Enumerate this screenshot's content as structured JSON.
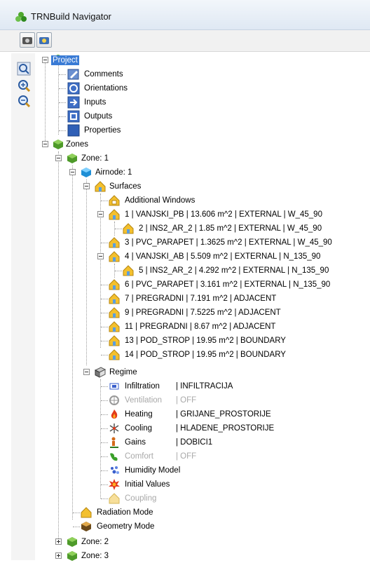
{
  "window": {
    "title": "TRNBuild Navigator"
  },
  "toolbar": {
    "buttons": [
      "camera-icon",
      "camera-color-icon"
    ]
  },
  "sidebar": {
    "buttons": [
      "zoom-fit-icon",
      "zoom-in-icon",
      "zoom-out-icon"
    ]
  },
  "tree": {
    "project": "Project",
    "comments": "Comments",
    "orientations": "Orientations",
    "inputs": "Inputs",
    "outputs": "Outputs",
    "properties": "Properties",
    "zones": "Zones",
    "zone1": "Zone: 1",
    "airnode1": "Airnode: 1",
    "surfaces": "Surfaces",
    "additional_windows": "Additional Windows",
    "surface_items": [
      "1  |  VANJSKI_PB  |  13.606 m^2  |  EXTERNAL  |  W_45_90",
      "2  |  INS2_AR_2  |  1.85 m^2  |  EXTERNAL  |  W_45_90",
      "3  |  PVC_PARAPET  |  1.3625 m^2  |  EXTERNAL  |  W_45_90",
      "4  |  VANJSKI_AB  |  5.509 m^2  |  EXTERNAL  |  N_135_90",
      "5  |  INS2_AR_2  |  4.292 m^2  |  EXTERNAL  |  N_135_90",
      "6  |  PVC_PARAPET  |  3.161 m^2  |  EXTERNAL  |  N_135_90",
      "7  |  PREGRADNI  |  7.191 m^2  |  ADJACENT",
      "9  |  PREGRADNI  |  7.5225 m^2  |  ADJACENT",
      "11  |  PREGRADNI  |  8.67 m^2  |  ADJACENT",
      "13  |  POD_STROP  |  19.95 m^2  |  BOUNDARY",
      "14  |  POD_STROP  |  19.95 m^2  |  BOUNDARY"
    ],
    "regime": "Regime",
    "regime_items": [
      {
        "name": "Infiltration",
        "value": "|  INFILTRACIJA",
        "enabled": true
      },
      {
        "name": "Ventilation",
        "value": "|  OFF",
        "enabled": false
      },
      {
        "name": "Heating",
        "value": "|  GRIJANE_PROSTORIJE",
        "enabled": true
      },
      {
        "name": "Cooling",
        "value": "|  HLADENE_PROSTORIJE",
        "enabled": true
      },
      {
        "name": "Gains",
        "value": "|  DOBICI1",
        "enabled": true
      },
      {
        "name": "Comfort",
        "value": "|  OFF",
        "enabled": false
      },
      {
        "name": "Humidity Model",
        "value": "",
        "enabled": true
      },
      {
        "name": "Initial Values",
        "value": "",
        "enabled": true
      },
      {
        "name": "Coupling",
        "value": "",
        "enabled": false
      }
    ],
    "radiation_mode": "Radiation Mode",
    "geometry_mode": "Geometry Mode",
    "zone2": "Zone: 2",
    "zone3": "Zone: 3"
  },
  "colors": {
    "selection": "#3a7bd5",
    "disabled_text": "#a8a8a8",
    "zone_green": "#4e9a2a",
    "house_yellow": "#f3c02e"
  }
}
